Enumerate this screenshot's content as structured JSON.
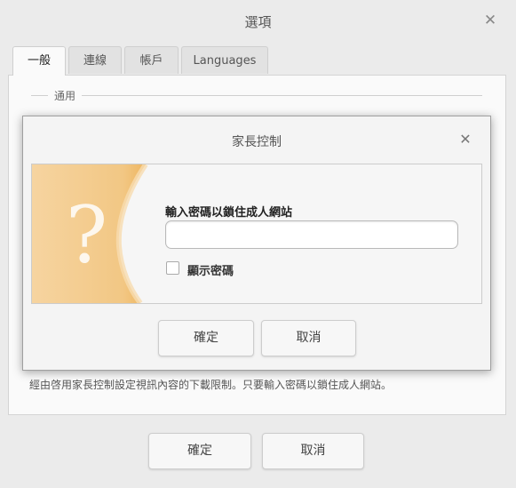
{
  "window": {
    "title": "選項",
    "close_glyph": "✕"
  },
  "tabs": [
    {
      "label": "一般",
      "active": true
    },
    {
      "label": "連線",
      "active": false
    },
    {
      "label": "帳戶",
      "active": false
    },
    {
      "label": "Languages",
      "active": false
    }
  ],
  "general": {
    "group_label": "通用",
    "description": "經由啓用家長控制設定視訊內容的下載限制。只要輸入密碼以鎖住成人網站。"
  },
  "footer": {
    "ok_label": "確定",
    "cancel_label": "取消"
  },
  "dialog": {
    "title": "家長控制",
    "close_glyph": "✕",
    "icon": "question-mark-icon",
    "icon_glyph": "?",
    "prompt": "輸入密碼以鎖住成人網站",
    "password_value": "",
    "show_password_label": "顯示密碼",
    "show_password_checked": false,
    "ok_label": "確定",
    "cancel_label": "取消"
  },
  "colors": {
    "accent_orange": "#f3c27a",
    "window_bg": "#ebebeb"
  }
}
